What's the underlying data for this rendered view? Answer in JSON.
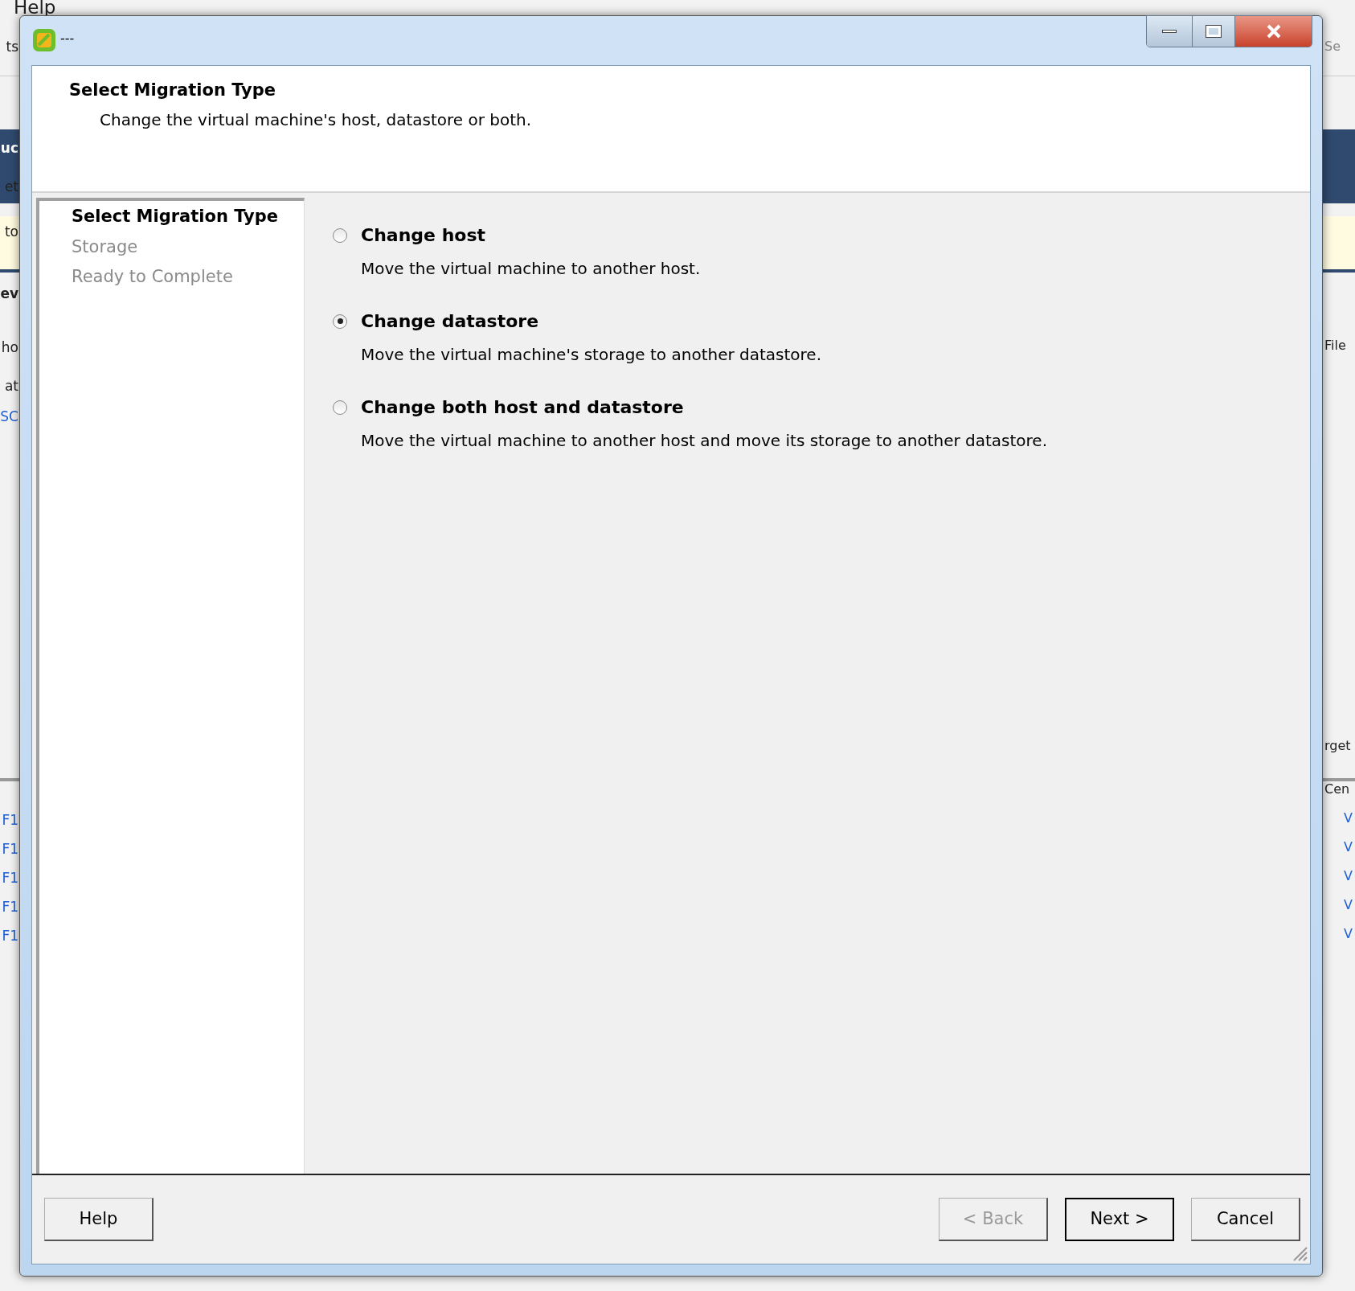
{
  "background": {
    "menu": "Help",
    "left": [
      {
        "text": "ts",
        "kind": "plain"
      },
      {
        "text": "uc",
        "kind": "band"
      },
      {
        "text": "et",
        "kind": "plain"
      },
      {
        "text": "to",
        "kind": "plain"
      },
      {
        "text": "ev",
        "kind": "bold"
      },
      {
        "text": "ho",
        "kind": "plain"
      },
      {
        "text": "at",
        "kind": "plain"
      },
      {
        "text": "SC",
        "kind": "link"
      },
      {
        "text": "F1",
        "kind": "link"
      },
      {
        "text": "F1",
        "kind": "link"
      },
      {
        "text": "F1",
        "kind": "link"
      },
      {
        "text": "F1",
        "kind": "link"
      },
      {
        "text": "F1",
        "kind": "link"
      }
    ],
    "right": [
      {
        "text": "Se",
        "kind": "field"
      },
      {
        "text": "File",
        "kind": "plain"
      },
      {
        "text": "rget",
        "kind": "plain"
      },
      {
        "text": "Cen",
        "kind": "plain"
      },
      {
        "text": "V",
        "kind": "link"
      },
      {
        "text": "V",
        "kind": "link"
      },
      {
        "text": "V",
        "kind": "link"
      },
      {
        "text": "V",
        "kind": "link"
      },
      {
        "text": "V",
        "kind": "link"
      }
    ]
  },
  "dialog": {
    "title": "---",
    "header": {
      "title": "Select Migration Type",
      "subtitle": "Change the virtual machine's host, datastore or both."
    },
    "steps": [
      {
        "label": "Select Migration Type",
        "selected": true
      },
      {
        "label": "Storage",
        "selected": false
      },
      {
        "label": "Ready to Complete",
        "selected": false
      }
    ],
    "options": [
      {
        "label": "Change host",
        "description": "Move the virtual machine to another host.",
        "selected": false
      },
      {
        "label": "Change datastore",
        "description": "Move the virtual machine's storage to another datastore.",
        "selected": true
      },
      {
        "label": "Change both host and datastore",
        "description": "Move the virtual machine to another host and move its storage to another datastore.",
        "selected": false
      }
    ],
    "buttons": [
      {
        "label": "Help",
        "kind": "help",
        "disabled": false,
        "default": false
      },
      {
        "label": "< Back",
        "kind": "nav",
        "disabled": true,
        "default": false
      },
      {
        "label": "Next >",
        "kind": "nav",
        "disabled": false,
        "default": true
      },
      {
        "label": "Cancel",
        "kind": "nav",
        "disabled": false,
        "default": false
      }
    ]
  }
}
